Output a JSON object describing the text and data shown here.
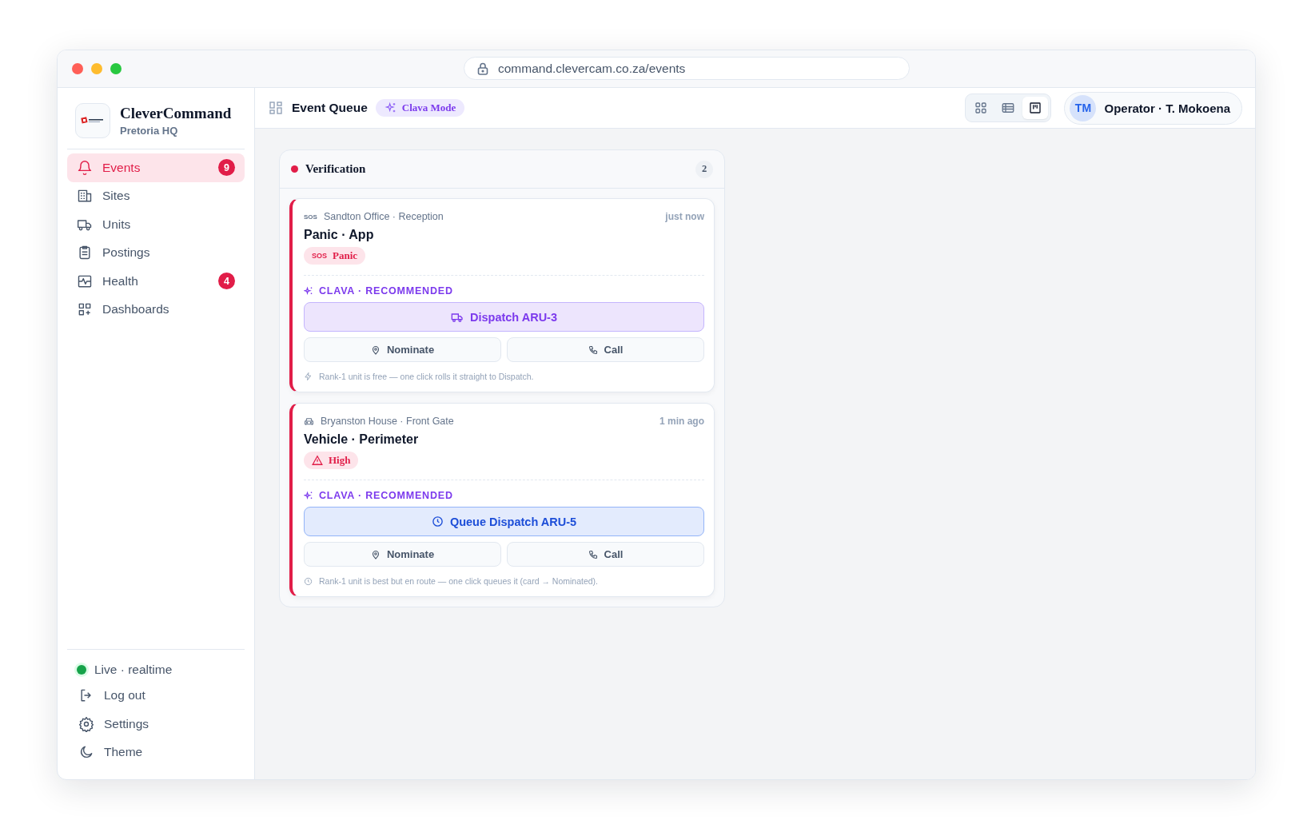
{
  "browser": {
    "url": "command.clevercam.co.za/events"
  },
  "brand": {
    "name": "CleverCommand",
    "subtitle": "Pretoria HQ"
  },
  "nav": [
    {
      "label": "Events",
      "kind": "bell",
      "selected": true,
      "badge": "9"
    },
    {
      "label": "Sites",
      "kind": "building",
      "selected": false
    },
    {
      "label": "Units",
      "kind": "truck",
      "selected": false
    },
    {
      "label": "Postings",
      "kind": "clipboard",
      "selected": false
    },
    {
      "label": "Health",
      "kind": "pulse",
      "selected": false,
      "badge": "4"
    },
    {
      "label": "Dashboards",
      "kind": "grid-plus",
      "selected": false
    }
  ],
  "status": {
    "label": "Live · realtime",
    "color": "#16a34a"
  },
  "footer_nav": [
    {
      "label": "Log out",
      "kind": "logout"
    },
    {
      "label": "Settings",
      "kind": "gear"
    },
    {
      "label": "Theme",
      "kind": "moon"
    }
  ],
  "header": {
    "title": "Event Queue",
    "mode_chip": "Clava Mode",
    "views": [
      {
        "kind": "grid",
        "selected": false
      },
      {
        "kind": "list",
        "selected": false
      },
      {
        "kind": "board",
        "selected": true
      }
    ],
    "user": {
      "initials": "TM",
      "name": "Operator · T. Mokoena"
    }
  },
  "column": {
    "title": "Verification",
    "color": "#e11d48",
    "count": "2",
    "cards": [
      {
        "source": {
          "kind": "sos",
          "icon_text": "SOS"
        },
        "location": "Sandton Office · Reception",
        "time": "just now",
        "title": "Panic · App",
        "tag": {
          "kind": "sos",
          "icon_text": "SOS",
          "label": "Panic"
        },
        "recommendation": "CLAVA · RECOMMENDED",
        "primary": {
          "kind": "dispatch",
          "label": "Dispatch ARU-3"
        },
        "actions": [
          "Nominate",
          "Call"
        ],
        "note": {
          "kind": "bolt",
          "text": "Rank-1 unit is free — one click rolls it straight to Dispatch."
        }
      },
      {
        "source": {
          "kind": "car"
        },
        "location": "Bryanston House · Front Gate",
        "time": "1 min ago",
        "title": "Vehicle · Perimeter",
        "tag": {
          "kind": "warning",
          "label": "High"
        },
        "recommendation": "CLAVA · RECOMMENDED",
        "primary": {
          "kind": "queue",
          "label": "Queue Dispatch ARU-5"
        },
        "actions": [
          "Nominate",
          "Call"
        ],
        "note": {
          "kind": "clock",
          "text": "Rank-1 unit is best but en route — one click queues it (card → Nominated)."
        }
      }
    ]
  }
}
